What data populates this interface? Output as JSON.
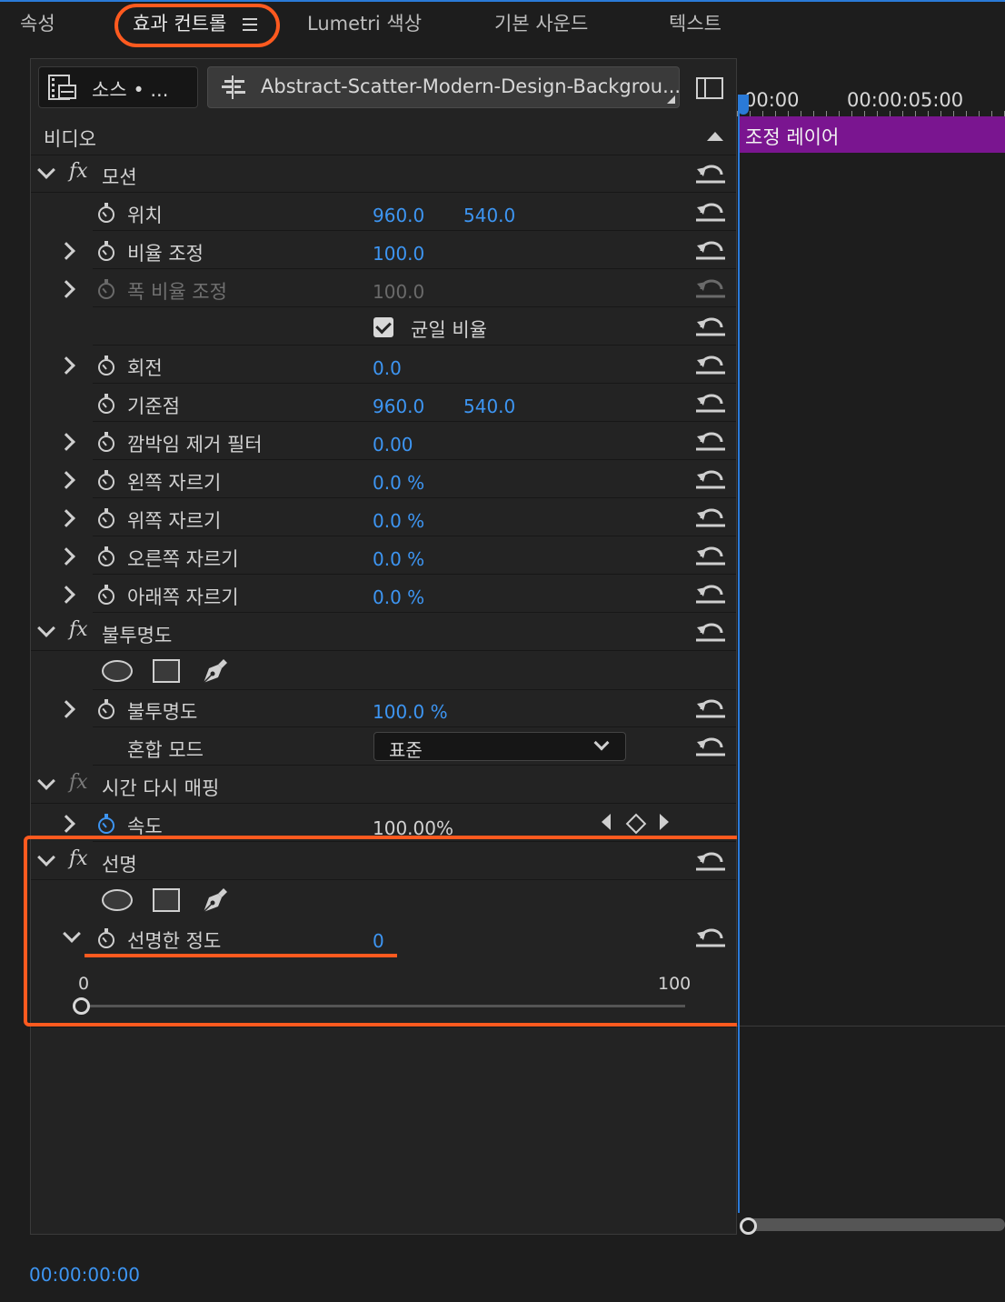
{
  "tabs": [
    {
      "label": "속성",
      "active": false
    },
    {
      "label": "효과 컨트롤",
      "active": true
    },
    {
      "label": "Lumetri 색상",
      "active": false
    },
    {
      "label": "기본 사운드",
      "active": false
    },
    {
      "label": "텍스트",
      "active": false
    }
  ],
  "source": {
    "source_label": "소스 • ...",
    "clip_name": "Abstract-Scatter-Modern-Design-Backgrou..."
  },
  "section_video": "비디오",
  "motion": {
    "title": "모션",
    "position": {
      "label": "위치",
      "x": "960.0",
      "y": "540.0"
    },
    "scale": {
      "label": "비율 조정",
      "value": "100.0"
    },
    "scale_width": {
      "label": "폭 비율 조정",
      "value": "100.0"
    },
    "uniform_scale": {
      "label": "균일 비율",
      "checked": true
    },
    "rotation": {
      "label": "회전",
      "value": "0.0"
    },
    "anchor": {
      "label": "기준점",
      "x": "960.0",
      "y": "540.0"
    },
    "anti_flicker": {
      "label": "깜박임 제거 필터",
      "value": "0.00"
    },
    "crop_left": {
      "label": "왼쪽 자르기",
      "value": "0.0 %"
    },
    "crop_top": {
      "label": "위쪽 자르기",
      "value": "0.0 %"
    },
    "crop_right": {
      "label": "오른쪽 자르기",
      "value": "0.0 %"
    },
    "crop_bottom": {
      "label": "아래쪽 자르기",
      "value": "0.0 %"
    }
  },
  "opacity": {
    "title": "불투명도",
    "opacity": {
      "label": "불투명도",
      "value": "100.0 %"
    },
    "blend_mode": {
      "label": "혼합 모드",
      "value": "표준"
    }
  },
  "time_remap": {
    "title": "시간 다시 매핑",
    "speed": {
      "label": "속도",
      "value": "100.00%"
    }
  },
  "sharpen": {
    "title": "선명",
    "amount": {
      "label": "선명한 정도",
      "value": "0"
    },
    "slider": {
      "min": "0",
      "max": "100",
      "value": 0
    }
  },
  "timeline": {
    "tc_start": "00:00",
    "tc_mark": "00:00:05:00",
    "clip_label": "조정 레이어"
  },
  "current_time": "00:00:00:00",
  "colors": {
    "accent_blue": "#3d95f2",
    "highlight_orange": "#ff5a1f",
    "clip_purple": "#7a1590"
  }
}
